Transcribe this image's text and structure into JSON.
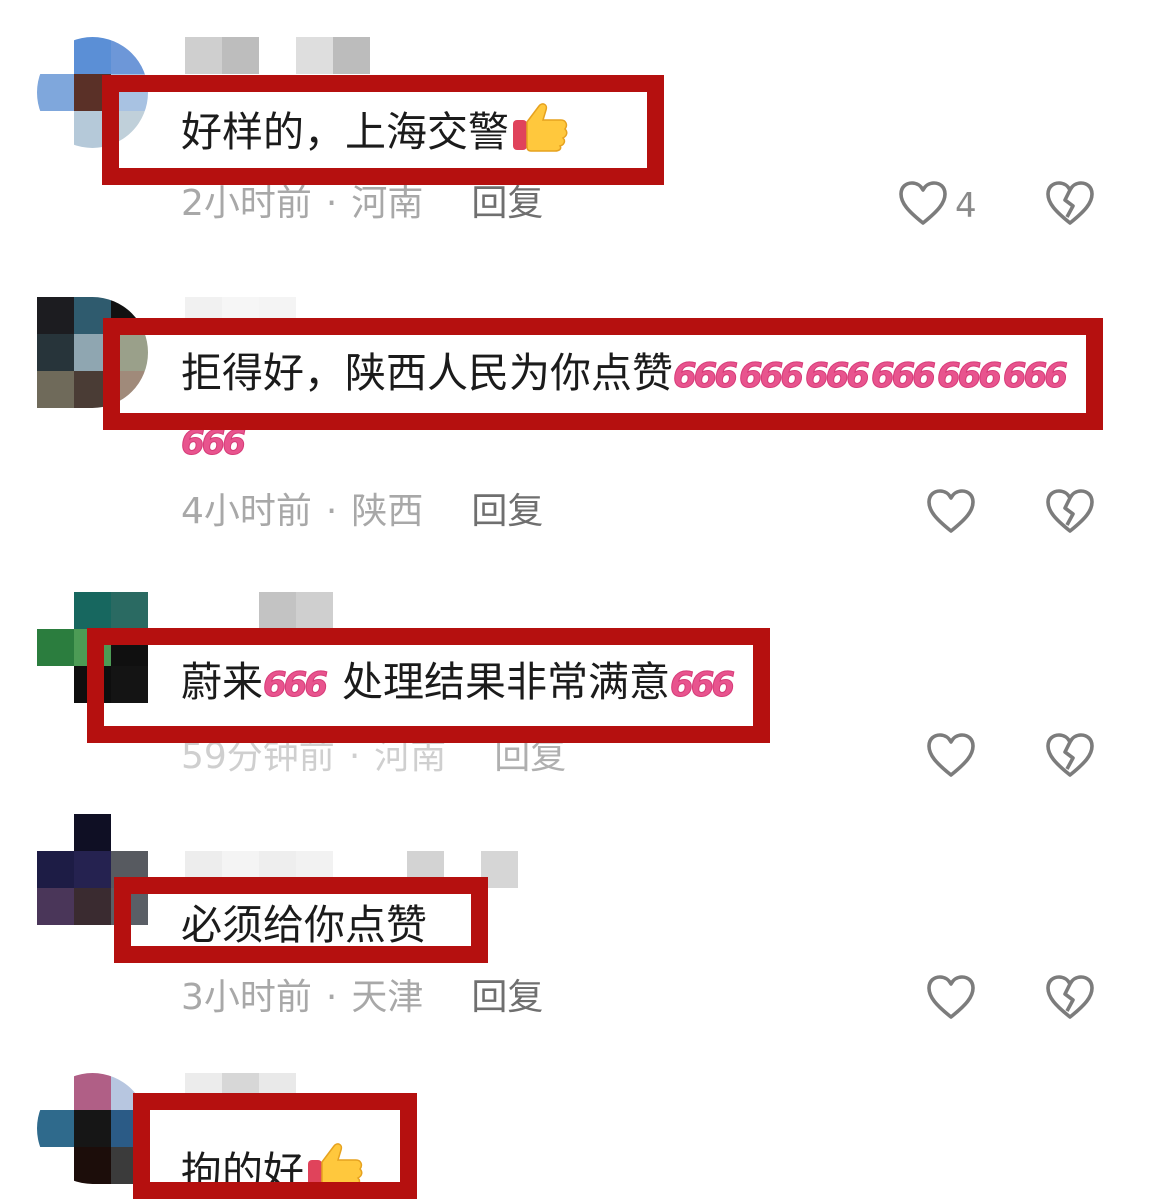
{
  "comments": [
    {
      "text": "好样的，上海交警",
      "emoji": "thumbs-up",
      "time": "2小时前",
      "location": "河南",
      "reply_label": "回复",
      "like_count": "4"
    },
    {
      "text": "拒得好，陕西人民为你点赞",
      "six": [
        "666",
        "666",
        "666",
        "666",
        "666",
        "666",
        "666"
      ],
      "time": "4小时前",
      "location": "陕西",
      "reply_label": "回复",
      "like_count": ""
    },
    {
      "text_a": "蔚来",
      "text_b": "处理结果非常满意",
      "six": [
        "666",
        "666"
      ],
      "time": "59分钟前",
      "location": "河南",
      "reply_label": "回复",
      "like_count": ""
    },
    {
      "text": "必须给你点赞",
      "time": "3小时前",
      "location": "天津",
      "reply_label": "回复",
      "like_count": ""
    },
    {
      "text": "拘的好",
      "emoji": "thumbs-up"
    }
  ],
  "colors": {
    "highlight_border": "#b5100f",
    "text": "#1b1b1b",
    "meta": "#a8a8a8",
    "reply": "#6f6f6f",
    "six_pink": "#e8548e"
  },
  "icons": {
    "like": "heart-outline-icon",
    "dislike": "broken-heart-icon",
    "emoji": "thumbs-up-emoji-icon"
  }
}
